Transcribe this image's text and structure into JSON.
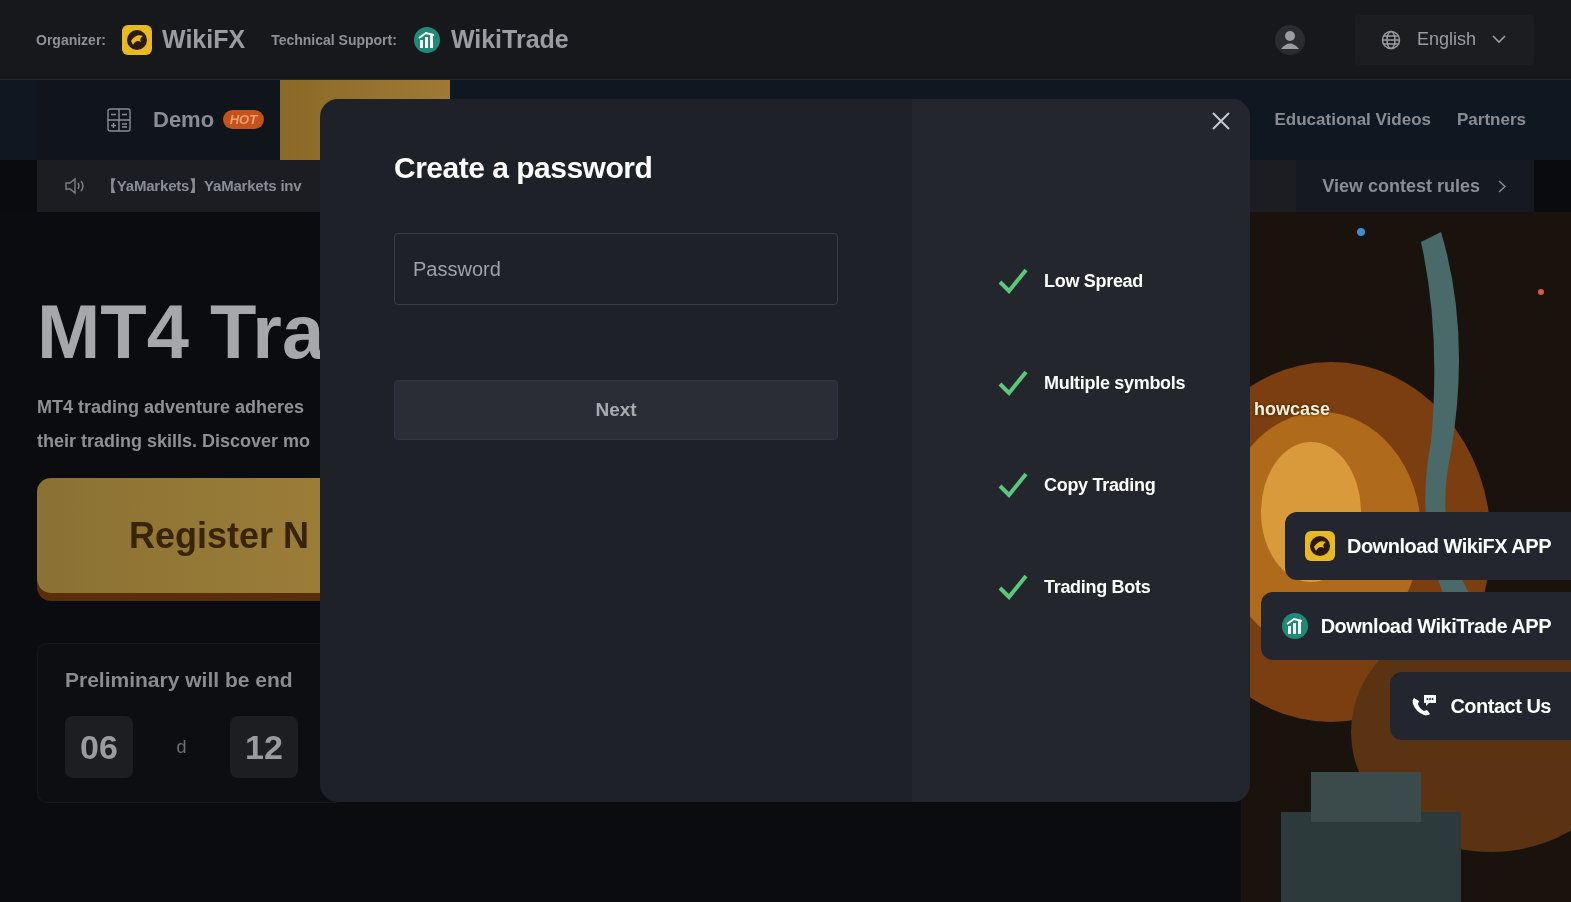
{
  "header": {
    "organizer_label": "Organizer:",
    "organizer_name": "WikiFX",
    "support_label": "Technical Support:",
    "support_name": "WikiTrade",
    "language": "English"
  },
  "nav": {
    "tabs": [
      {
        "label": "Demo",
        "badge": "HOT",
        "selected": false
      },
      {
        "selected": true
      }
    ],
    "links": [
      "Educational Videos",
      "Partners"
    ]
  },
  "ticker": {
    "text": "【YaMarkets】YaMarkets inv",
    "link": "View contest rules"
  },
  "hero": {
    "title": "MT4 Tra",
    "description_lines": [
      "MT4 trading adventure adheres",
      "their trading skills. Discover mo"
    ],
    "register_button": "Register N",
    "showcase": "howcase"
  },
  "countdown": {
    "label": "Preliminary will be end",
    "units": [
      {
        "value": "06",
        "unit": "d"
      },
      {
        "value": "12"
      }
    ]
  },
  "modal": {
    "title": "Create a password",
    "password": {
      "placeholder": "Password"
    },
    "next_button": "Next",
    "features": [
      "Low Spread",
      "Multiple symbols",
      "Copy Trading",
      "Trading Bots"
    ]
  },
  "floating_buttons": [
    {
      "kind": "wikifx",
      "label": "Download WikiFX APP"
    },
    {
      "kind": "wikitrade",
      "label": "Download WikiTrade APP"
    },
    {
      "kind": "contact",
      "label": "Contact Us"
    }
  ]
}
